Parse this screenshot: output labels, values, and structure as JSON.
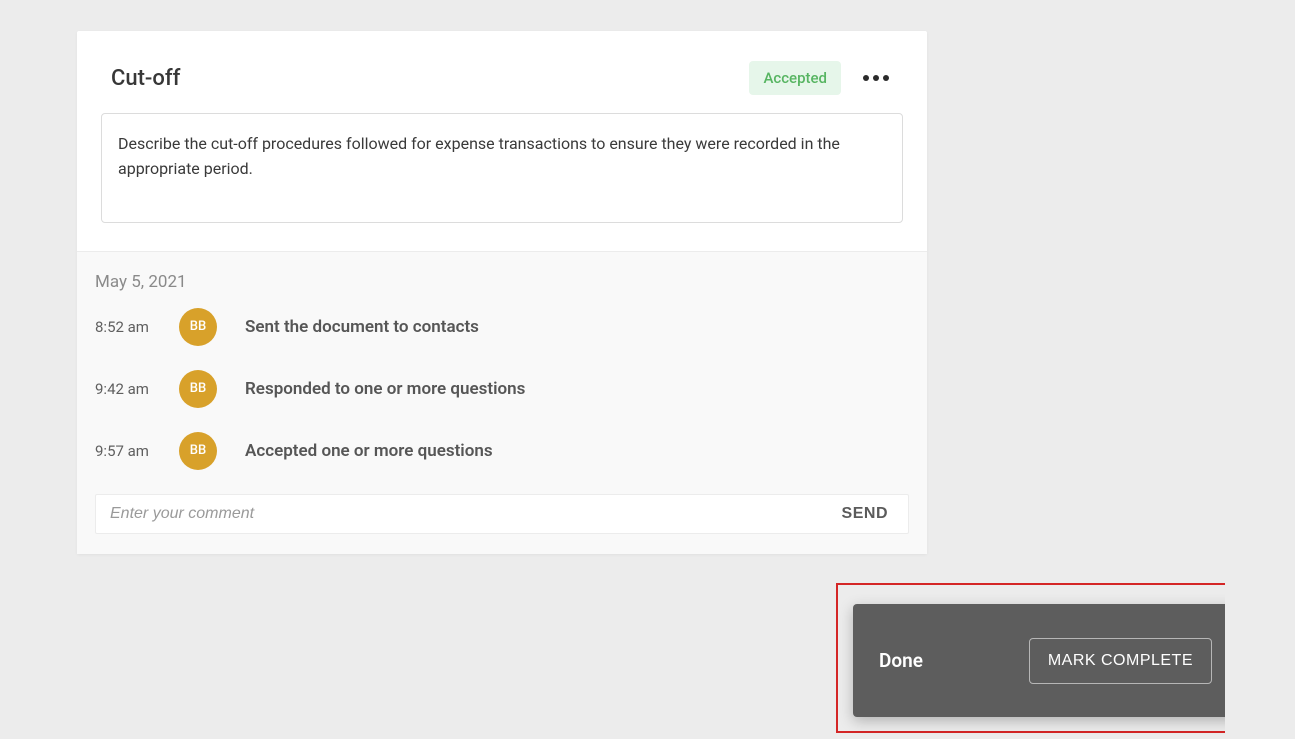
{
  "card": {
    "title": "Cut-off",
    "status": "Accepted",
    "description": "Describe the cut-off procedures followed for expense transactions to ensure they were recorded in the appropriate period."
  },
  "activity": {
    "date": "May 5, 2021",
    "items": [
      {
        "time": "8:52 am",
        "initials": "BB",
        "text": "Sent the document to contacts"
      },
      {
        "time": "9:42 am",
        "initials": "BB",
        "text": "Responded to one or more questions"
      },
      {
        "time": "9:57 am",
        "initials": "BB",
        "text": "Accepted one or more questions"
      }
    ]
  },
  "comment": {
    "placeholder": "Enter your comment",
    "send_label": "SEND"
  },
  "toast": {
    "title": "Done",
    "action_label": "MARK COMPLETE"
  }
}
